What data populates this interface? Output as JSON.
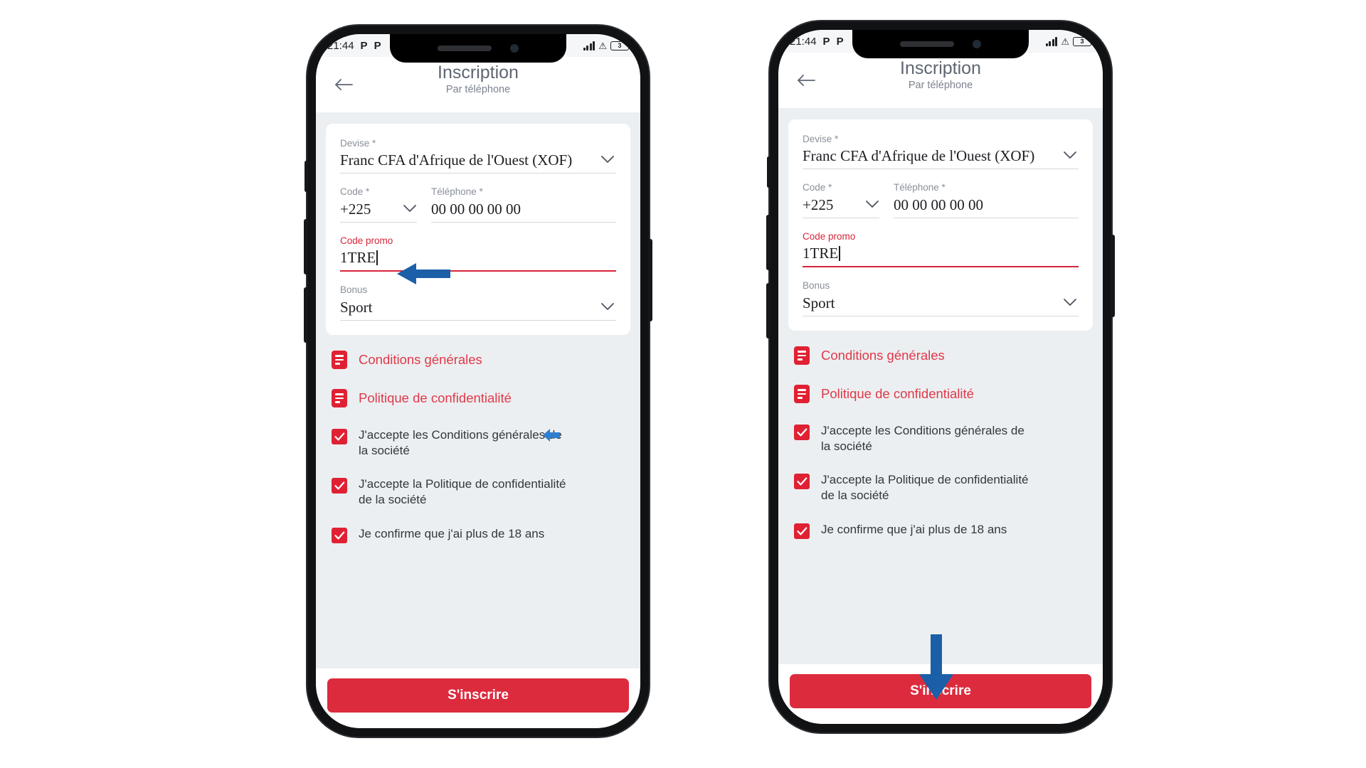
{
  "app": {
    "statusbar": {
      "time": "21:44",
      "badge1": "P",
      "badge2": "P",
      "signal_icon": "signal-bars-icon",
      "warning_icon": "warning-triangle-icon",
      "battery_level": "3"
    },
    "header": {
      "back_icon": "back-arrow-icon",
      "title": "Inscription",
      "subtitle": "Par téléphone"
    },
    "form": {
      "currency": {
        "label": "Devise *",
        "value": "Franc CFA d'Afrique de l'Ouest (XOF)",
        "chevron_icon": "chevron-down-icon"
      },
      "country_code": {
        "label": "Code *",
        "value": "+225",
        "chevron_icon": "chevron-down-icon"
      },
      "phone": {
        "label": "Téléphone *",
        "value": "00 00 00 00 00",
        "placeholder": "00 00 00 00 00"
      },
      "promo": {
        "label": "Code promo",
        "value": "1TRE",
        "label_color": "#d7253a",
        "underline_color": "#d7253a"
      },
      "bonus": {
        "label": "Bonus",
        "value": "Sport",
        "chevron_icon": "chevron-down-icon"
      }
    },
    "links": [
      {
        "icon": "document-icon",
        "label": "Conditions générales"
      },
      {
        "icon": "document-icon",
        "label": "Politique de confidentialité"
      }
    ],
    "checkboxes": [
      {
        "checked": true,
        "label": "J'accepte les Conditions générales de la société"
      },
      {
        "checked": true,
        "label": "J'accepte la Politique de confidentialité de la société"
      },
      {
        "checked": true,
        "label": "Je confirme que j'ai plus de 18 ans"
      }
    ],
    "footer": {
      "submit_label": "S'inscrire"
    },
    "colors": {
      "brand_red": "#dc2b3d",
      "link_red": "#e0394a",
      "checkbox_red": "#e02133",
      "annotation_blue": "#1b5fa8",
      "screen_bg": "#eceff1",
      "card_bg": "#ffffff"
    }
  },
  "annotations": [
    {
      "name": "promo-field-arrow",
      "direction": "left",
      "color": "#1b5fa8",
      "target": "Code promo field (phone 1)"
    },
    {
      "name": "privacy-link-arrow",
      "direction": "left",
      "color": "#2f7fd0",
      "target": "Politique de confidentialité (phone 1)"
    },
    {
      "name": "submit-button-arrow",
      "direction": "down",
      "color": "#1b5fa8",
      "target": "S'inscrire button (phone 2)"
    }
  ]
}
